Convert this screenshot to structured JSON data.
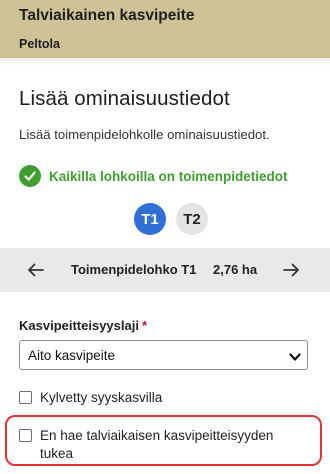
{
  "header": {
    "title": "Talviaikainen kasvipeite",
    "subtitle": "Peltola"
  },
  "main": {
    "title": "Lisää ominaisuustiedot",
    "intro": "Lisää toimenpidelohkolle ominaisuustiedot.",
    "status": {
      "icon": "check-circle-icon",
      "text": "Kaikilla lohkoilla on toimenpidetiedot",
      "color": "#3f9e2f"
    },
    "tabs": [
      {
        "label": "T1",
        "active": true
      },
      {
        "label": "T2",
        "active": false
      }
    ],
    "nav": {
      "prev_icon": "arrow-left-icon",
      "next_icon": "arrow-right-icon",
      "label": "Toimenpidelohko T1",
      "area": "2,76 ha"
    },
    "field": {
      "label": "Kasvipeitteisyyslaji",
      "required_mark": "*",
      "selected": "Aito kasvipeite"
    },
    "checkboxes": [
      {
        "label": "Kylvetty syyskasvilla",
        "checked": false
      },
      {
        "label": "En hae talviaikaisen kasvipeitteisyyden tukea",
        "checked": false
      }
    ]
  },
  "colors": {
    "header_bg": "#cdc397",
    "accent": "#2f6fd6",
    "highlight": "#e53238"
  }
}
